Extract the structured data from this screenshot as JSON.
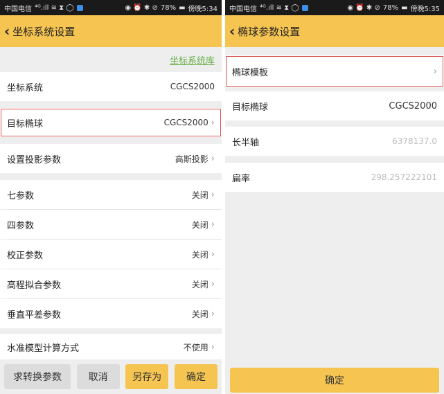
{
  "left": {
    "status": {
      "carrier": "中国电信",
      "signal": "⁴ᴳ.ıll ≋ ⧗ ◯",
      "right_icons": "◉ ⏰ ✱ ⊘",
      "battery": "78%",
      "time": "傍晚5:34"
    },
    "header": {
      "back": "‹",
      "title": "坐标系统设置"
    },
    "link": "坐标系统库",
    "rows": [
      {
        "label": "坐标系统",
        "value": "CGCS2000"
      },
      {
        "label": "目标椭球",
        "value": "CGCS2000"
      },
      {
        "label": "设置投影参数",
        "value": "高斯投影"
      },
      {
        "label": "七参数",
        "value": "关闭"
      },
      {
        "label": "四参数",
        "value": "关闭"
      },
      {
        "label": "校正参数",
        "value": "关闭"
      },
      {
        "label": "高程拟合参数",
        "value": "关闭"
      },
      {
        "label": "垂直平差参数",
        "value": "关闭"
      },
      {
        "label": "水准模型计算方式",
        "value": "不使用"
      }
    ],
    "buttons": {
      "compute": "求转换参数",
      "cancel": "取消",
      "save_as": "另存为",
      "ok": "确定"
    }
  },
  "right": {
    "status": {
      "carrier": "中国电信",
      "signal": "⁴ᴳ.ıll ≋ ⧗ ◯",
      "right_icons": "◉ ⏰ ✱ ⊘",
      "battery": "78%",
      "time": "傍晚5:35"
    },
    "header": {
      "back": "‹",
      "title": "椭球参数设置"
    },
    "rows": [
      {
        "label": "椭球模板",
        "value": ""
      },
      {
        "label": "目标椭球",
        "value": "CGCS2000"
      },
      {
        "label": "长半轴",
        "value": "6378137.0"
      },
      {
        "label": "扁率",
        "value": "298.257222101"
      }
    ],
    "ok": "确定"
  },
  "chevron": "›"
}
